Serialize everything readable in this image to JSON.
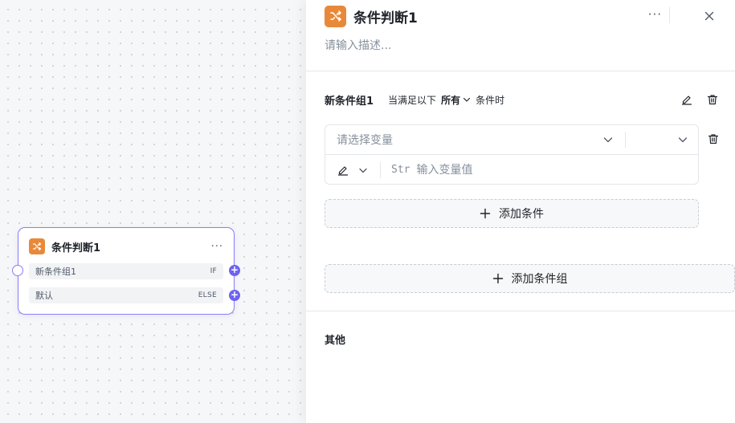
{
  "node": {
    "title": "条件判断1",
    "more": "···",
    "rows": [
      {
        "label": "新条件组1",
        "tag": "IF"
      },
      {
        "label": "默认",
        "tag": "ELSE"
      }
    ],
    "port_symbol": "+"
  },
  "panel": {
    "title": "条件判断1",
    "more": "···",
    "description_placeholder": "请输入描述...",
    "group": {
      "title": "新条件组1",
      "prefix": "当满足以下",
      "mode": "所有",
      "suffix": "条件时"
    },
    "condition": {
      "variable_placeholder": "请选择变量",
      "type_tag": "Str",
      "value_placeholder": "输入变量值"
    },
    "add_condition_label": "添加条件",
    "add_group_label": "添加条件组",
    "other_title": "其他"
  },
  "colors": {
    "accent": "#8b7cf6",
    "port": "#6e63f0",
    "node_icon": "#e8893a"
  },
  "icons": {
    "node": "shuffle-icon",
    "edit": "pencil-icon",
    "delete": "trash-icon",
    "close": "close-icon",
    "dropdown": "chevron-down-icon",
    "add": "plus-icon"
  }
}
